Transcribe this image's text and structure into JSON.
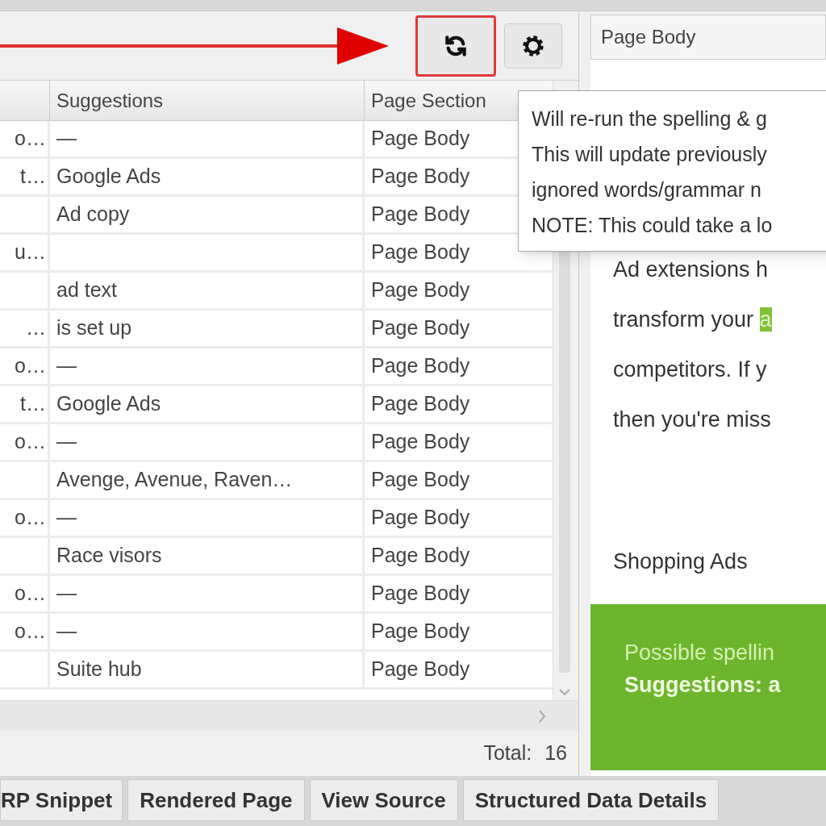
{
  "toolbar": {
    "buttons": [
      {
        "kind": "refresh",
        "annotated": true
      },
      {
        "kind": "settings",
        "annotated": false
      }
    ]
  },
  "table": {
    "columns": [
      "Suggestions",
      "Page Section"
    ],
    "rows": [
      {
        "column_1": "o…",
        "suggestions": "—",
        "page_section": "Page Body"
      },
      {
        "column_1": "t…",
        "suggestions": "Google Ads",
        "page_section": "Page Body"
      },
      {
        "column_1": "",
        "suggestions": "Ad copy",
        "page_section": "Page Body"
      },
      {
        "column_1": "u…",
        "suggestions": "",
        "page_section": "Page Body"
      },
      {
        "column_1": "",
        "suggestions": "ad text",
        "page_section": "Page Body"
      },
      {
        "column_1": "…",
        "suggestions": "is set up",
        "page_section": "Page Body"
      },
      {
        "column_1": "o…",
        "suggestions": "—",
        "page_section": "Page Body"
      },
      {
        "column_1": "t…",
        "suggestions": "Google Ads",
        "page_section": "Page Body"
      },
      {
        "column_1": "o…",
        "suggestions": "—",
        "page_section": "Page Body"
      },
      {
        "column_1": "",
        "suggestions": "Avenge, Avenue, Raven…",
        "page_section": "Page Body"
      },
      {
        "column_1": "o…",
        "suggestions": "—",
        "page_section": "Page Body"
      },
      {
        "column_1": "",
        "suggestions": "Race visors",
        "page_section": "Page Body"
      },
      {
        "column_1": "o…",
        "suggestions": "—",
        "page_section": "Page Body"
      },
      {
        "column_1": "o…",
        "suggestions": "—",
        "page_section": "Page Body"
      },
      {
        "column_1": "",
        "suggestions": "Suite hub",
        "page_section": "Page Body"
      }
    ],
    "total_label": "Total:",
    "total": "16"
  },
  "tooltip": [
    "Will re-run the spelling & g",
    "This will update previously",
    "ignored words/grammar n",
    "NOTE: This could take a lo"
  ],
  "preview": {
    "header": "Page Body",
    "lines": [
      {
        "text": "Ad extensions h"
      },
      {
        "text": "transform your ",
        "highlight": "a"
      },
      {
        "text": "competitors. If y"
      },
      {
        "text": "then you're miss"
      }
    ],
    "heading": "Shopping Ads",
    "notice": {
      "message": "Possible spellin",
      "suggestions": "Suggestions: a"
    }
  },
  "tabs": [
    {
      "label": "RP Snippet",
      "selected": false
    },
    {
      "label": "Rendered Page",
      "selected": false
    },
    {
      "label": "View Source",
      "selected": false
    },
    {
      "label": "Structured Data Details",
      "selected": false
    }
  ]
}
